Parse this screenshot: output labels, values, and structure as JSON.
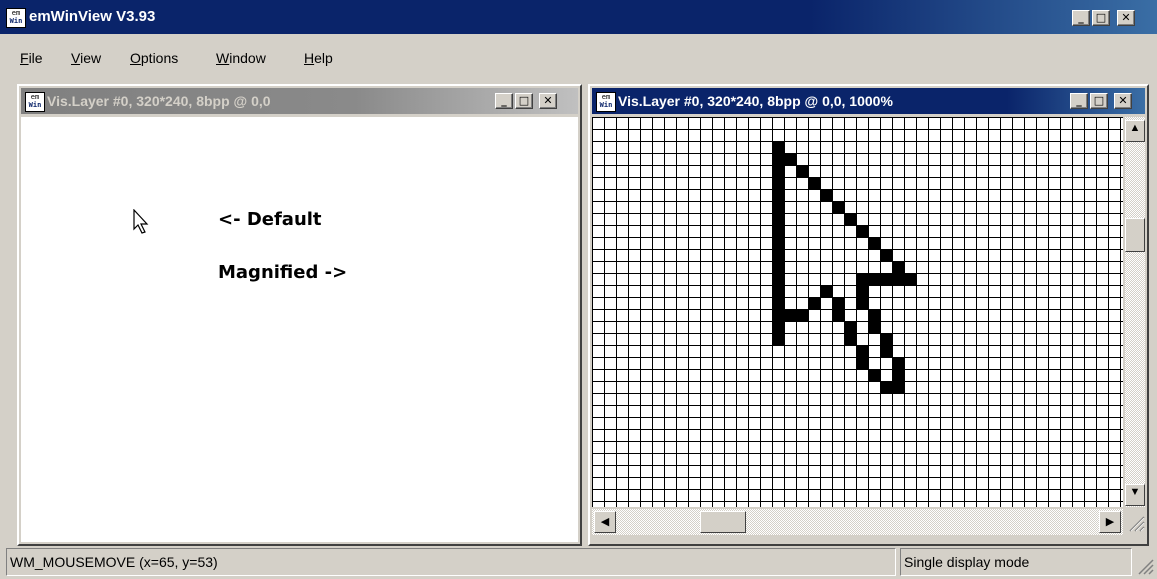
{
  "app": {
    "title": "emWinView V3.93",
    "icon_top": "em",
    "icon_bottom": "Win"
  },
  "menu": [
    "File",
    "View",
    "Options",
    "Window",
    "Help"
  ],
  "menu_accel": [
    "F",
    "V",
    "O",
    "W",
    "H"
  ],
  "caption_buttons": {
    "minimize": "_",
    "maximize": "□",
    "close": "✕"
  },
  "left_window": {
    "title": "Vis.Layer #0, 320*240, 8bpp @ 0,0",
    "label_default": "<- Default",
    "label_magnified": "Magnified ->"
  },
  "right_window": {
    "title": "Vis.Layer #0, 320*240, 8bpp @ 0,0, 1000%",
    "magnification": "1000%"
  },
  "scroll": {
    "up": "▲",
    "down": "▼",
    "left": "◀",
    "right": "▶"
  },
  "status": {
    "message": "WM_MOUSEMOVE (x=65, y=53)",
    "mode": "Single display mode"
  },
  "colors": {
    "active_title": "#0a246a",
    "inactive_title": "#808080",
    "face": "#d4d0c8"
  },
  "icons": [
    "app-icon",
    "arrow-cursor-icon",
    "size-grip-icon"
  ]
}
